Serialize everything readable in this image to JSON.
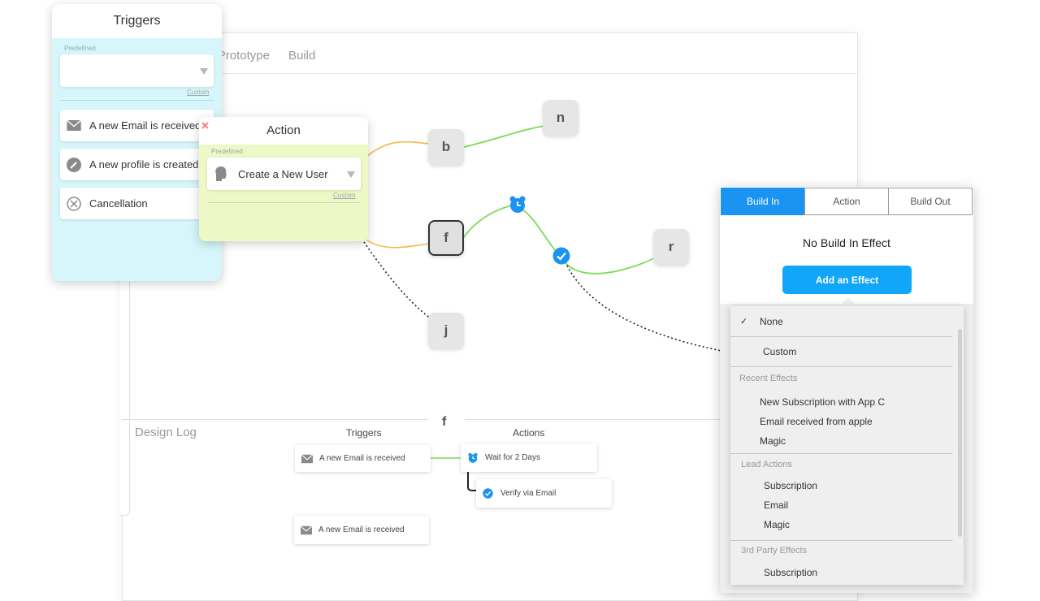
{
  "canvas": {
    "tabs": [
      "Prototype",
      "Build"
    ],
    "nodes": {
      "b": "b",
      "n": "n",
      "f": "f",
      "r": "r",
      "j": "j"
    }
  },
  "triggers_panel": {
    "title": "Triggers",
    "predefined_label": "Predefined",
    "select_value": "",
    "custom_link": "Custom",
    "items": [
      {
        "label": "A new Email is received",
        "icon": "envelope-icon"
      },
      {
        "label": "A new profile is created",
        "icon": "pencil-icon"
      },
      {
        "label": "Cancellation",
        "icon": "cancel-icon"
      }
    ]
  },
  "action_panel": {
    "title": "Action",
    "predefined_label": "Predefined",
    "select_value": "Create a New User",
    "custom_link": "Custom"
  },
  "design_log": {
    "title": "Design Log",
    "node_label": "f",
    "triggers_heading": "Triggers",
    "actions_heading": "Actions",
    "trigger_card_1": "A new Email is received",
    "trigger_card_2": "A new Email is received",
    "action_card_1": "Wait for 2 Days",
    "action_card_2": "Verify via Email"
  },
  "effects_panel": {
    "tabs": [
      "Build In",
      "Action",
      "Build Out"
    ],
    "active_tab": "Build In",
    "status": "No Build In Effect",
    "add_button": "Add an Effect",
    "dropdown": {
      "none": "None",
      "checkmark": "✓",
      "custom": "Custom",
      "recent_heading": "Recent Effects",
      "recent": [
        "New Subscription with App C",
        "Email received from apple",
        "Magic"
      ],
      "lead_heading": "Lead Actions",
      "lead": [
        "Subscription",
        "Email",
        "Magic"
      ],
      "third_party_heading": "3rd Party Effects",
      "third_party": [
        "Subscription"
      ]
    }
  },
  "colors": {
    "accent_blue": "#11a6f7",
    "trigger_panel_bg": "#d6f6fb",
    "action_panel_bg": "#eef8c6",
    "green_link": "#7ed957",
    "orange_link": "#f5b942"
  }
}
